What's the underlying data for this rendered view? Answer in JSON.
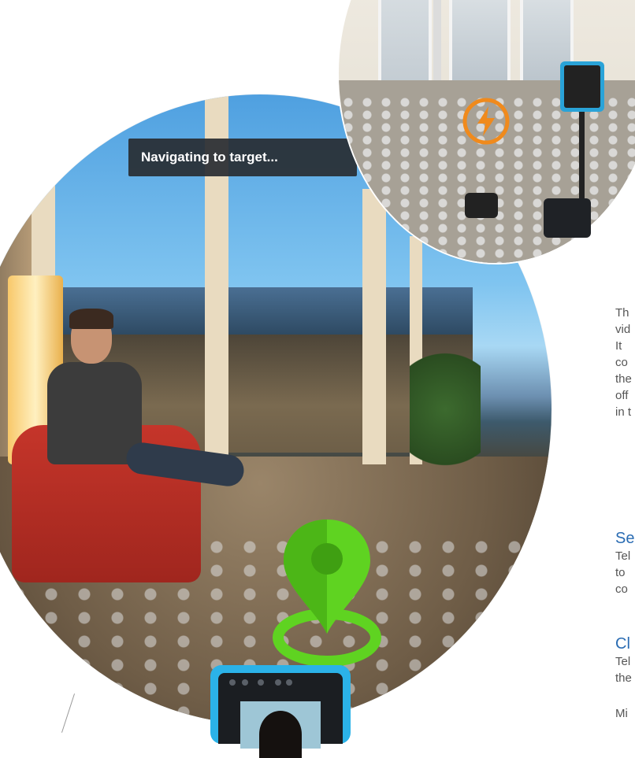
{
  "main_view": {
    "toast_text": "Navigating to target..."
  },
  "top_view": {
    "icon": "charging-bolt-icon"
  },
  "right_column": {
    "paragraph_lines": [
      "Th",
      "vid",
      "It",
      "co",
      "the",
      "off",
      "in t"
    ],
    "sections": [
      {
        "heading": "Se",
        "lines": [
          "Tel",
          "to",
          "co"
        ]
      },
      {
        "heading": "Cl",
        "lines": [
          "Tel",
          "the"
        ]
      }
    ],
    "trailing_line": "Mi"
  },
  "colors": {
    "pin_green": "#5fd321",
    "tablet_blue": "#2bb2e8",
    "charge_orange": "#f08a1c",
    "heading_blue": "#2a6cb3",
    "toast_bg": "#282c32"
  }
}
